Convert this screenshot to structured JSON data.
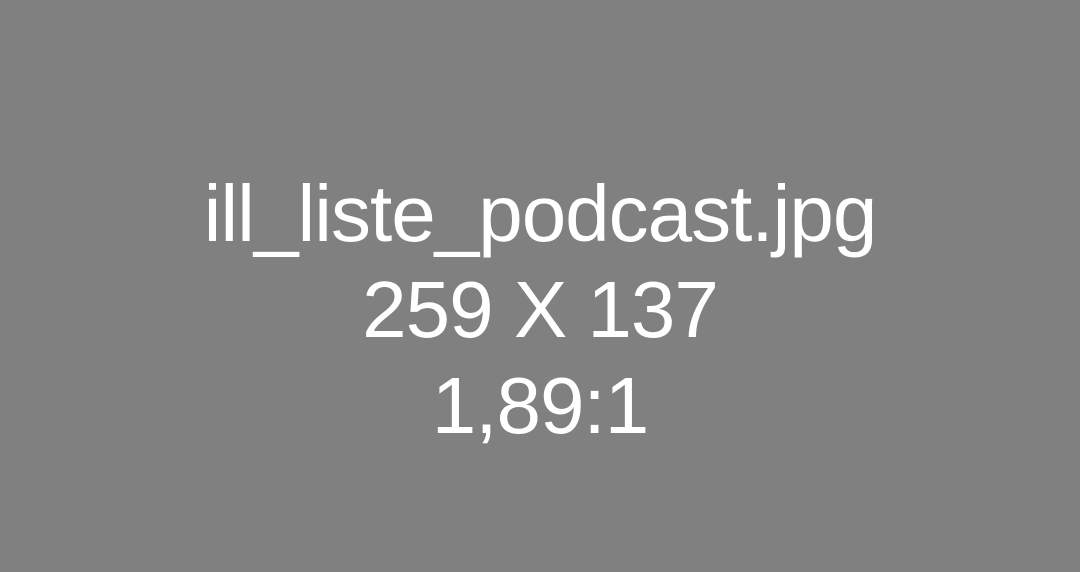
{
  "placeholder": {
    "filename": "ill_liste_podcast.jpg",
    "dimensions": "259 X 137",
    "ratio": "1,89:1",
    "colors": {
      "background": "#808080",
      "text": "#ffffff"
    }
  }
}
